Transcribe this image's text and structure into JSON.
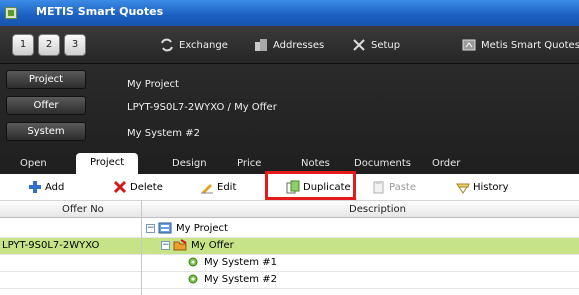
{
  "window": {
    "title": "METIS Smart Quotes"
  },
  "toolbar": {
    "pages": [
      "1",
      "2",
      "3"
    ],
    "exchange_label": "Exchange",
    "addresses_label": "Addresses",
    "setup_label": "Setup",
    "smartquotes_label": "Metis Smart Quotes"
  },
  "context": {
    "project_button": "Project",
    "project_value": "My Project",
    "offer_button": "Offer",
    "offer_value": "LPYT-9S0L7-2WYXO / My Offer",
    "system_button": "System",
    "system_value": "My System #2"
  },
  "tabs": [
    "Open",
    "Project",
    "Design",
    "Price",
    "Notes",
    "Documents",
    "Order"
  ],
  "actions": {
    "add": "Add",
    "delete": "Delete",
    "edit": "Edit",
    "duplicate": "Duplicate",
    "paste": "Paste",
    "history": "History"
  },
  "grid": {
    "headers": {
      "offer_no": "Offer No",
      "description": "Description"
    },
    "rows": [
      {
        "offer_no": "",
        "description": "My Project"
      },
      {
        "offer_no": "LPYT-9S0L7-2WYXO",
        "description": "My Offer"
      },
      {
        "offer_no": "",
        "description": "My System #1"
      },
      {
        "offer_no": "",
        "description": "My System #2"
      }
    ]
  },
  "colors": {
    "title_bar": "#1b5fc0",
    "selected_row": "#c6e487",
    "highlight": "#e31b1b"
  }
}
